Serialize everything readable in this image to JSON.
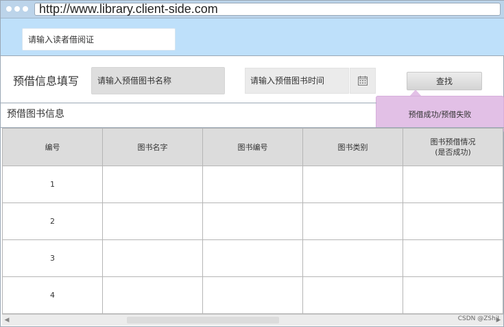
{
  "browser": {
    "url": "http://www.library.client-side.com"
  },
  "reader": {
    "placeholder": "请输入读者借阅证"
  },
  "form": {
    "label": "预借信息填写",
    "book_placeholder": "请输入预借图书名称",
    "date_placeholder": "请输入预借图书时间",
    "search_label": "查找"
  },
  "tooltip": {
    "text": "预借成功/预借失败"
  },
  "section": {
    "title": "预借图书信息"
  },
  "table": {
    "headers": [
      "编号",
      "图书名字",
      "图书编号",
      "图书类别",
      "图书预借情况\n(是否成功)"
    ],
    "rows": [
      [
        "1",
        "",
        "",
        "",
        ""
      ],
      [
        "2",
        "",
        "",
        "",
        ""
      ],
      [
        "3",
        "",
        "",
        "",
        ""
      ],
      [
        "4",
        "",
        "",
        "",
        ""
      ]
    ]
  },
  "watermark": "CSDN @ZShiJ",
  "icons": {
    "calendar": "calendar-icon",
    "scroll_left": "scroll-left-icon",
    "scroll_right": "scroll-right-icon"
  }
}
